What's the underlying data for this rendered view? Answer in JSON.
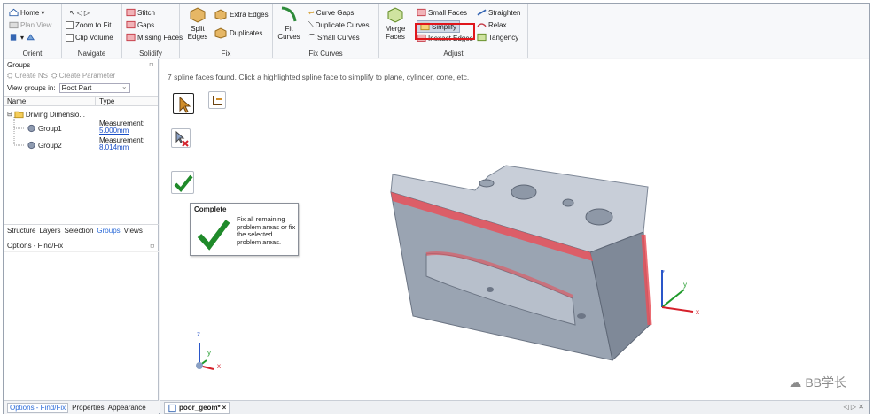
{
  "ribbon": {
    "orient": {
      "label": "Orient",
      "home": "Home",
      "plan_view": "Plan View"
    },
    "navigate": {
      "label": "Navigate",
      "zoom_to_fit": "Zoom to Fit",
      "clip_volume": "Clip Volume"
    },
    "solidify": {
      "label": "Solidify",
      "stitch": "Stitch",
      "gaps": "Gaps",
      "missing_faces": "Missing Faces"
    },
    "fix": {
      "label": "Fix",
      "split_edges": "Split Edges",
      "extra_edges": "Extra Edges",
      "duplicates": "Duplicates"
    },
    "fix_curves": {
      "label": "Fix Curves",
      "fit_curves": "Fit Curves",
      "curve_gaps": "Curve Gaps",
      "duplicate_curves": "Duplicate Curves",
      "small_curves": "Small Curves"
    },
    "adjust": {
      "label": "Adjust",
      "merge_faces": "Merge Faces",
      "small_faces": "Small Faces",
      "simplify": "Simplify",
      "inexact_edges": "Inexact Edges",
      "straighten": "Straighten",
      "relax": "Relax",
      "tangency": "Tangency"
    }
  },
  "groups_panel": {
    "title": "Groups",
    "create_ns": "Create NS",
    "create_parameter": "Create Parameter",
    "view_groups_in_label": "View groups in:",
    "view_groups_in_value": "Root Part",
    "columns": [
      "Name",
      "Type"
    ],
    "tree": {
      "folder": "Driving Dimensio...",
      "items": [
        {
          "name": "Group1",
          "type_label": "Measurement:",
          "value": "5.000mm"
        },
        {
          "name": "Group2",
          "type_label": "Measurement:",
          "value": "8.014mm"
        }
      ]
    },
    "tabs": [
      "Structure",
      "Layers",
      "Selection",
      "Groups",
      "Views"
    ],
    "active_tab": "Groups"
  },
  "options_panel": {
    "title": "Options - Find/Fix"
  },
  "bottom_tabs": {
    "items": [
      "Options - Find/Fix",
      "Properties",
      "Appearance"
    ],
    "active": "Options - Find/Fix"
  },
  "viewport": {
    "status_message": "7 spline faces found. Click a highlighted spline face to simplify to plane, cylinder, cone, etc.",
    "tooltip": {
      "title": "Complete",
      "body": "Fix all remaining problem areas or fix the selected problem areas."
    },
    "axes": {
      "x": "x",
      "y": "y",
      "z": "z"
    },
    "watermark": "BB学长"
  },
  "doc_tabs": {
    "active": "poor_geom*",
    "nav": "◁ ▷ ✕"
  },
  "colors": {
    "highlight": "#e0161c",
    "part": "#9aa4b2",
    "spline_face": "#e8525a"
  }
}
